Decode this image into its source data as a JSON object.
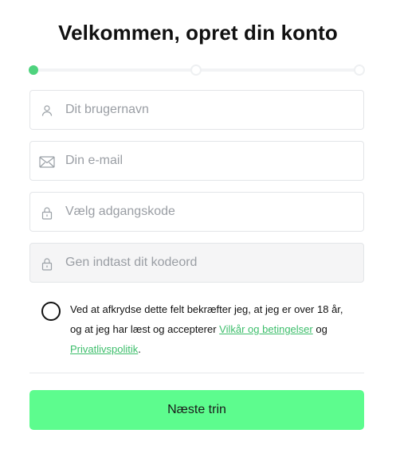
{
  "header": {
    "title": "Velkommen, opret din konto"
  },
  "progress": {
    "current_step": 1,
    "total_steps": 3,
    "accent_color": "#4fd37e"
  },
  "form": {
    "username": {
      "placeholder": "Dit brugernavn",
      "value": "",
      "icon": "user-icon"
    },
    "email": {
      "placeholder": "Din e-mail",
      "value": "",
      "icon": "mail-icon"
    },
    "password": {
      "placeholder": "Vælg adgangskode",
      "value": "",
      "icon": "lock-icon"
    },
    "password_confirm": {
      "placeholder": "Gen indtast dit kodeord",
      "value": "",
      "icon": "lock-icon"
    }
  },
  "consent": {
    "checked": false,
    "text_before": "Ved at afkrydse dette felt bekræfter jeg, at jeg er over 18 år, og at jeg har læst og accepterer ",
    "terms_link": "Vilkår og betingelser",
    "text_middle": " og ",
    "privacy_link": "Privatlivspolitik",
    "text_after": ".",
    "link_color": "#3dbe6b"
  },
  "actions": {
    "next_label": "Næste trin",
    "button_color": "#5dfc8e"
  }
}
